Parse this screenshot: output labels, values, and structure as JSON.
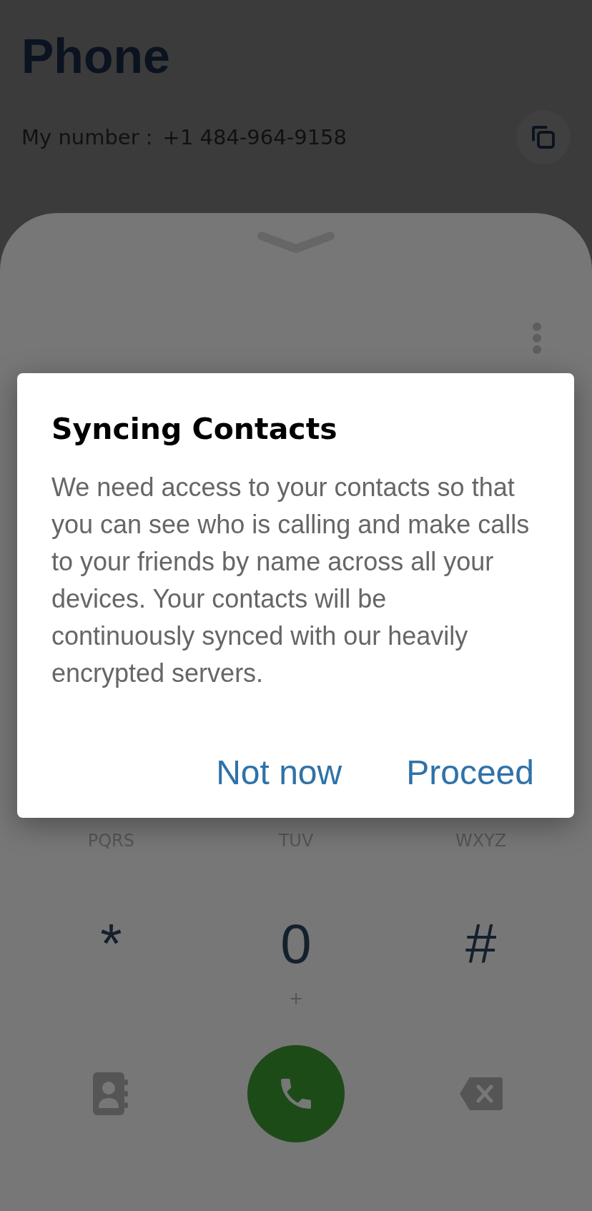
{
  "header": {
    "title": "Phone",
    "my_number_label": "My number :",
    "my_number": "+1 484-964-9158"
  },
  "keypad": {
    "letters": [
      "PQRS",
      "TUV",
      "WXYZ"
    ],
    "keys": [
      {
        "symbol": "*"
      },
      {
        "symbol": "0",
        "sub": "+"
      },
      {
        "symbol": "#"
      }
    ]
  },
  "dialog": {
    "title": "Syncing Contacts",
    "message": "We need access to your contacts so that you can see who is calling and make calls to your friends by name across all your devices. Your contacts will be continuously synced with our heavily encrypted servers.",
    "buttons": [
      "Not now",
      "Proceed"
    ]
  }
}
